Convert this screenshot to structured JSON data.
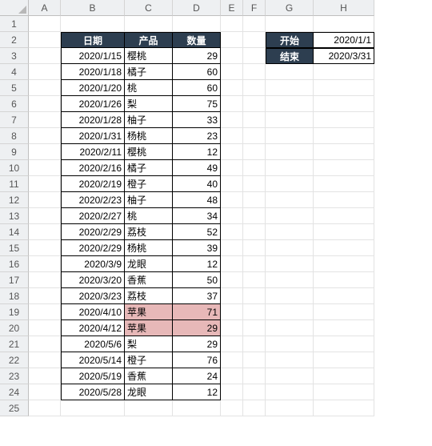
{
  "columns": [
    "A",
    "B",
    "C",
    "D",
    "E",
    "F",
    "G",
    "H"
  ],
  "row_count": 25,
  "table": {
    "headers": {
      "date": "日期",
      "product": "产品",
      "qty": "数量"
    },
    "rows": [
      {
        "date": "2020/1/15",
        "product": "樱桃",
        "qty": "29",
        "hl": false
      },
      {
        "date": "2020/1/18",
        "product": "橘子",
        "qty": "60",
        "hl": false
      },
      {
        "date": "2020/1/20",
        "product": "桃",
        "qty": "60",
        "hl": false
      },
      {
        "date": "2020/1/26",
        "product": "梨",
        "qty": "75",
        "hl": false
      },
      {
        "date": "2020/1/28",
        "product": "柚子",
        "qty": "33",
        "hl": false
      },
      {
        "date": "2020/1/31",
        "product": "杨桃",
        "qty": "23",
        "hl": false
      },
      {
        "date": "2020/2/11",
        "product": "樱桃",
        "qty": "12",
        "hl": false
      },
      {
        "date": "2020/2/16",
        "product": "橘子",
        "qty": "49",
        "hl": false
      },
      {
        "date": "2020/2/19",
        "product": "橙子",
        "qty": "40",
        "hl": false
      },
      {
        "date": "2020/2/23",
        "product": "柚子",
        "qty": "48",
        "hl": false
      },
      {
        "date": "2020/2/27",
        "product": "桃",
        "qty": "34",
        "hl": false
      },
      {
        "date": "2020/2/29",
        "product": "荔枝",
        "qty": "52",
        "hl": false
      },
      {
        "date": "2020/2/29",
        "product": "杨桃",
        "qty": "39",
        "hl": false
      },
      {
        "date": "2020/3/9",
        "product": "龙眼",
        "qty": "12",
        "hl": false
      },
      {
        "date": "2020/3/20",
        "product": "香蕉",
        "qty": "50",
        "hl": false
      },
      {
        "date": "2020/3/23",
        "product": "荔枝",
        "qty": "37",
        "hl": false
      },
      {
        "date": "2020/4/10",
        "product": "苹果",
        "qty": "71",
        "hl": true
      },
      {
        "date": "2020/4/12",
        "product": "苹果",
        "qty": "29",
        "hl": true
      },
      {
        "date": "2020/5/6",
        "product": "梨",
        "qty": "29",
        "hl": false
      },
      {
        "date": "2020/5/14",
        "product": "橙子",
        "qty": "76",
        "hl": false
      },
      {
        "date": "2020/5/19",
        "product": "香蕉",
        "qty": "24",
        "hl": false
      },
      {
        "date": "2020/5/28",
        "product": "龙眼",
        "qty": "12",
        "hl": false
      }
    ]
  },
  "filter": {
    "start_label": "开始",
    "start_value": "2020/1/1",
    "end_label": "结束",
    "end_value": "2020/3/31"
  },
  "chart_data": {
    "type": "table",
    "title": "",
    "columns": [
      "日期",
      "产品",
      "数量"
    ],
    "rows": [
      [
        "2020/1/15",
        "樱桃",
        29
      ],
      [
        "2020/1/18",
        "橘子",
        60
      ],
      [
        "2020/1/20",
        "桃",
        60
      ],
      [
        "2020/1/26",
        "梨",
        75
      ],
      [
        "2020/1/28",
        "柚子",
        33
      ],
      [
        "2020/1/31",
        "杨桃",
        23
      ],
      [
        "2020/2/11",
        "樱桃",
        12
      ],
      [
        "2020/2/16",
        "橘子",
        49
      ],
      [
        "2020/2/19",
        "橙子",
        40
      ],
      [
        "2020/2/23",
        "柚子",
        48
      ],
      [
        "2020/2/27",
        "桃",
        34
      ],
      [
        "2020/2/29",
        "荔枝",
        52
      ],
      [
        "2020/2/29",
        "杨桃",
        39
      ],
      [
        "2020/3/9",
        "龙眼",
        12
      ],
      [
        "2020/3/20",
        "香蕉",
        50
      ],
      [
        "2020/3/23",
        "荔枝",
        37
      ],
      [
        "2020/4/10",
        "苹果",
        71
      ],
      [
        "2020/4/12",
        "苹果",
        29
      ],
      [
        "2020/5/6",
        "梨",
        29
      ],
      [
        "2020/5/14",
        "橙子",
        76
      ],
      [
        "2020/5/19",
        "香蕉",
        24
      ],
      [
        "2020/5/28",
        "龙眼",
        12
      ]
    ],
    "filter": {
      "start": "2020/1/1",
      "end": "2020/3/31"
    },
    "highlighted_rows": [
      16,
      17
    ]
  }
}
